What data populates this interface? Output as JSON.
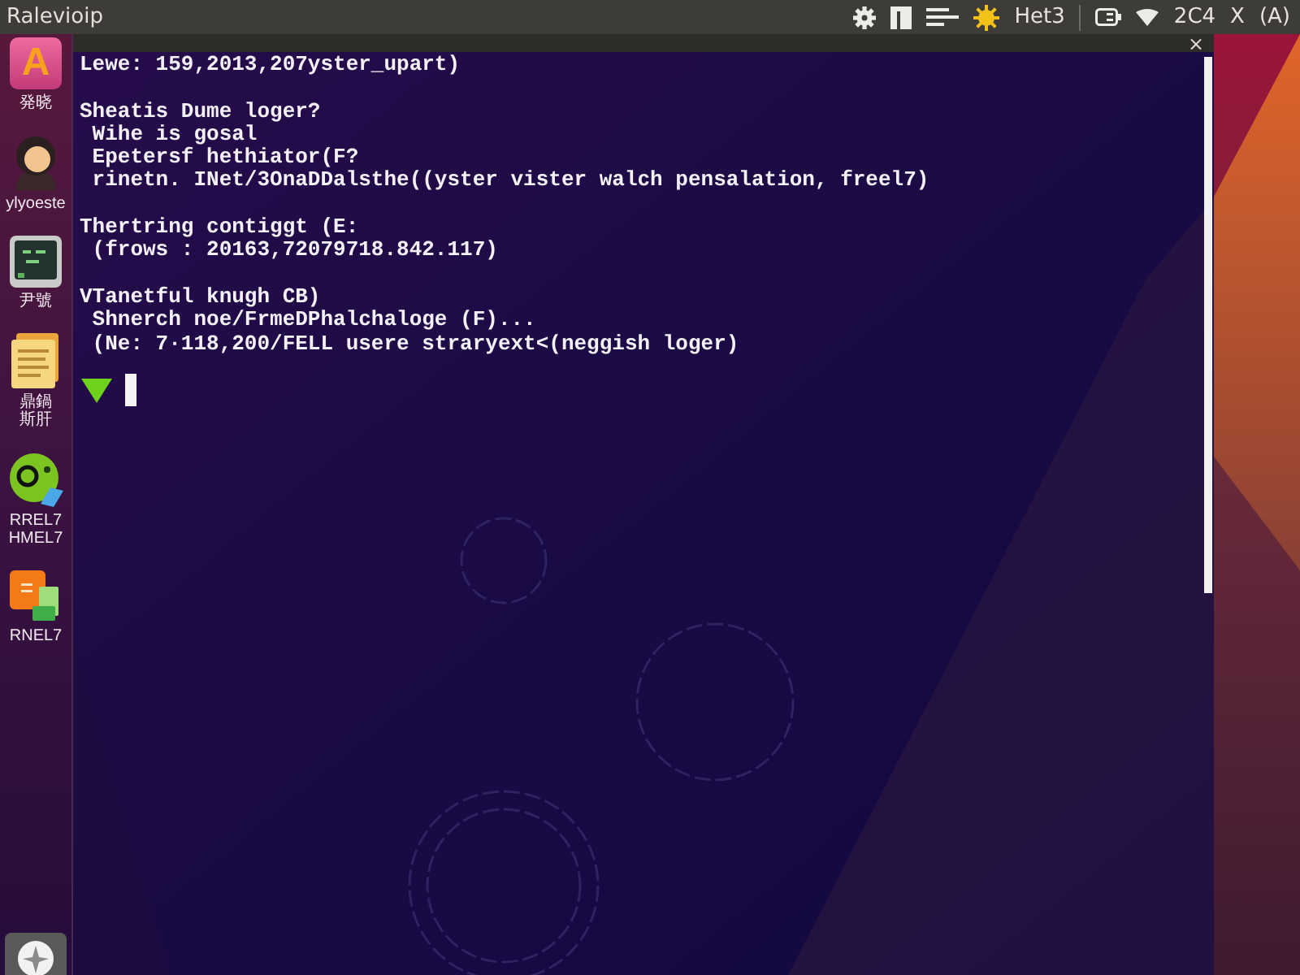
{
  "top_bar": {
    "title": "Ralevioip",
    "indicators": [
      {
        "kind": "gear"
      },
      {
        "kind": "document"
      },
      {
        "kind": "lines"
      },
      {
        "kind": "sun"
      },
      {
        "kind": "text",
        "text": "Het3"
      },
      {
        "kind": "divider"
      },
      {
        "kind": "battery"
      },
      {
        "kind": "wifi"
      },
      {
        "kind": "text",
        "text": "2C4"
      },
      {
        "kind": "text",
        "text": "X"
      },
      {
        "kind": "text",
        "text": "(A)"
      }
    ]
  },
  "launcher": {
    "items": [
      {
        "kind": "letter",
        "glyph": "A",
        "label": [
          "発晓"
        ]
      },
      {
        "kind": "avatar",
        "label": [
          "ylyoeste"
        ]
      },
      {
        "kind": "terminal",
        "label": [
          "尹號"
        ]
      },
      {
        "kind": "folder",
        "label": [
          "鼎鍋",
          "斯肝"
        ]
      },
      {
        "kind": "ball",
        "label": [
          "RREL7",
          "HMEL7"
        ]
      },
      {
        "kind": "orange",
        "label": [
          "RNEL7"
        ]
      }
    ],
    "bottom": {
      "kind": "dash"
    }
  },
  "terminal": {
    "close_glyph": "×",
    "blocks": [
      {
        "lines": [
          "Lewe: 159,2013,207yster_upart)"
        ]
      },
      {
        "lines": [
          "Sheatis Dume loger?",
          " Wihe is gosal",
          " Epetersf hethiator(F?",
          " rinetn. INet/3OnaDDalsthe((yster vister walch pensalation, freel7)"
        ]
      },
      {
        "lines": [
          "Thertring contiggt (E:",
          " (frows : 20163,72079718.842.117)"
        ]
      },
      {
        "lines": [
          "VTanetful knugh CB)",
          " Shnerch noe/FrmeDPhalchaloge (F)...",
          " (Ne: 7·118,200/FELL usere straryext<(neggish loger)"
        ]
      }
    ]
  }
}
